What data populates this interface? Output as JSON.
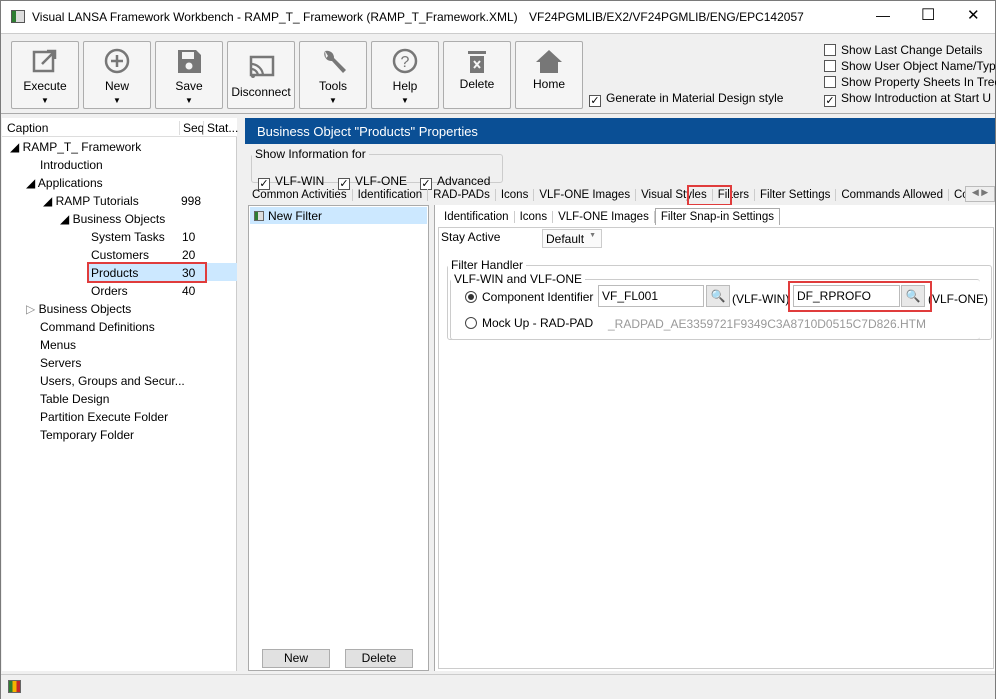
{
  "window": {
    "title": "Visual LANSA Framework Workbench - RAMP_T_ Framework (RAMP_T_Framework.XML)",
    "path": "VF24PGMLIB/EX2/VF24PGMLIB/ENG/EPC142057",
    "minimize": "—",
    "maximize": "☐",
    "close": "✕"
  },
  "toolbar": {
    "buttons": [
      {
        "label": "Execute",
        "icon": "external-icon"
      },
      {
        "label": "New",
        "icon": "plus-icon"
      },
      {
        "label": "Save",
        "icon": "save-icon"
      },
      {
        "label": "Disconnect",
        "icon": "cast-icon"
      },
      {
        "label": "Tools",
        "icon": "wrench-icon"
      },
      {
        "label": "Help",
        "icon": "help-icon"
      },
      {
        "label": "Delete",
        "icon": "trash-icon"
      },
      {
        "label": "Home",
        "icon": "home-icon"
      }
    ],
    "material": "Generate in Material Design style",
    "options": [
      {
        "label": "Show Last Change Details",
        "checked": false
      },
      {
        "label": "Show User Object Name/Typ",
        "checked": false
      },
      {
        "label": "Show Property Sheets In Tree",
        "checked": false
      },
      {
        "label": "Show Introduction at Start U",
        "checked": true
      }
    ]
  },
  "tree": {
    "headers": [
      "Caption",
      "Seq",
      "Stat..."
    ],
    "items": [
      {
        "label": "RAMP_T_ Framework",
        "seq": ""
      },
      {
        "label": "Introduction",
        "seq": ""
      },
      {
        "label": "Applications",
        "seq": ""
      },
      {
        "label": "RAMP Tutorials",
        "seq": "998"
      },
      {
        "label": "Business Objects",
        "seq": ""
      },
      {
        "label": "System Tasks",
        "seq": "10"
      },
      {
        "label": "Customers",
        "seq": "20"
      },
      {
        "label": "Products",
        "seq": "30"
      },
      {
        "label": "Orders",
        "seq": "40"
      },
      {
        "label": "Business Objects",
        "seq": ""
      },
      {
        "label": "Command Definitions",
        "seq": ""
      },
      {
        "label": "Menus",
        "seq": ""
      },
      {
        "label": "Servers",
        "seq": ""
      },
      {
        "label": "Users, Groups and Secur...",
        "seq": ""
      },
      {
        "label": "Table Design",
        "seq": ""
      },
      {
        "label": "Partition Execute Folder",
        "seq": ""
      },
      {
        "label": "Temporary Folder",
        "seq": ""
      }
    ]
  },
  "props": {
    "header": "Business Object \"Products\" Properties",
    "show_info": "Show Information for",
    "show_opts": [
      "VLF-WIN",
      "VLF-ONE",
      "Advanced"
    ],
    "tabs": [
      "Common Activities",
      "Identification",
      "RAD-PADs",
      "Icons",
      "VLF-ONE Images",
      "Visual Styles",
      "Filters",
      "Filter Settings",
      "Commands Allowed",
      "Command"
    ],
    "filters": [
      "New Filter"
    ],
    "new_btn": "New",
    "delete_btn": "Delete",
    "subtabs": [
      "Identification",
      "Icons",
      "VLF-ONE Images",
      "Filter Snap-in Settings"
    ],
    "stay_active": "Stay Active",
    "stay_value": "Default",
    "filter_handler": "Filter Handler",
    "vlf_group": "VLF-WIN and VLF-ONE",
    "component_id": "Component Identifier",
    "win_value": "VF_FL001",
    "win_suffix": "(VLF-WIN)",
    "one_value": "DF_RPROFO",
    "one_suffix": "(VLF-ONE)",
    "mockup": "Mock Up - RAD-PAD",
    "mockup_value": "_RADPAD_AE3359721F9349C3A8710D0515C7D826.HTM"
  },
  "colors": {
    "header": "#0a4f95",
    "selection": "#cce8ff",
    "highlight": "#e03c3c"
  }
}
